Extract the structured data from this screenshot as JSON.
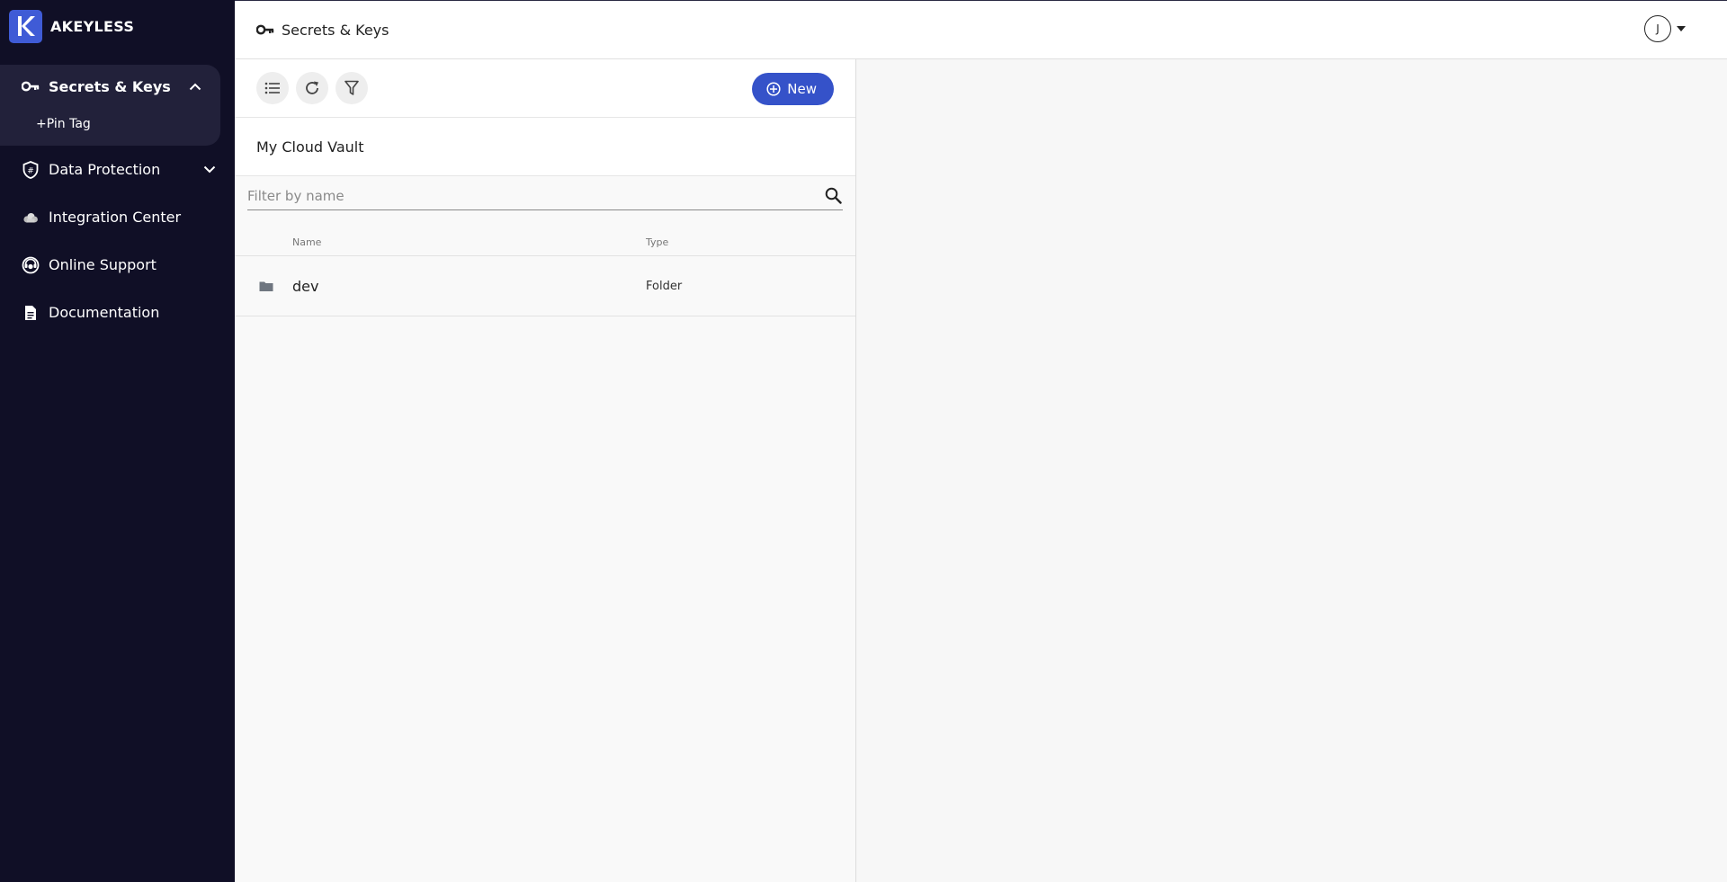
{
  "brand": {
    "name": "AKEYLESS",
    "logo_letter": "K"
  },
  "sidebar": {
    "items": [
      {
        "label": "Secrets & Keys",
        "icon": "key-icon",
        "expanded": true
      },
      {
        "label": "Data Protection",
        "icon": "shield-icon",
        "expanded": false
      },
      {
        "label": "Integration Center",
        "icon": "cloud-icon"
      },
      {
        "label": "Online Support",
        "icon": "support-icon"
      },
      {
        "label": "Documentation",
        "icon": "document-icon"
      }
    ],
    "sub_items": [
      {
        "label": "+Pin Tag"
      }
    ]
  },
  "topbar": {
    "title": "Secrets & Keys",
    "user_initial": "J"
  },
  "toolbar": {
    "new_label": "New"
  },
  "vault": {
    "title": "My Cloud Vault"
  },
  "search": {
    "placeholder": "Filter by name",
    "value": ""
  },
  "table": {
    "columns": [
      "Name",
      "Type"
    ],
    "rows": [
      {
        "name": "dev",
        "type": "Folder",
        "icon": "folder-icon"
      }
    ]
  },
  "colors": {
    "sidebar_bg": "#100f26",
    "accent": "#3552c9",
    "logo_bg": "#3f5bd6"
  }
}
